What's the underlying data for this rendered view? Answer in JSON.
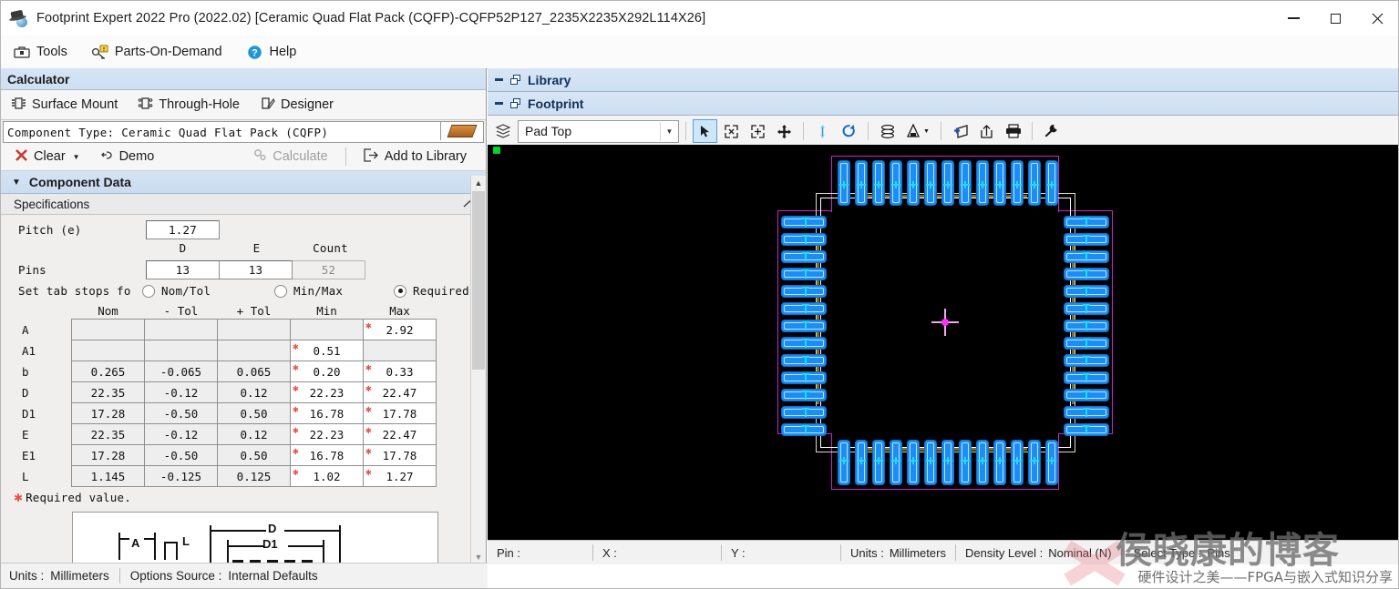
{
  "window": {
    "title": "Footprint Expert 2022 Pro (2022.02) [Ceramic Quad Flat Pack (CQFP)-CQFP52P127_2235X2235X292L114X26]",
    "app_icon": "chip-hat-icon",
    "minimize": "—",
    "maximize": "□",
    "close": "✕"
  },
  "menubar": {
    "items": [
      {
        "label": "Tools",
        "icon": "toolbox-icon"
      },
      {
        "label": "Parts-On-Demand",
        "icon": "parts-on-demand-icon"
      },
      {
        "label": "Help",
        "icon": "help-question-icon"
      }
    ]
  },
  "calculator": {
    "header": "Calculator",
    "tabs": [
      {
        "label": "Surface Mount",
        "icon": "surface-mount-icon"
      },
      {
        "label": "Through-Hole",
        "icon": "through-hole-icon"
      },
      {
        "label": "Designer",
        "icon": "designer-icon"
      }
    ],
    "component_type": "Component Type: Ceramic Quad Flat Pack (CQFP)",
    "actions": [
      {
        "label": "Clear",
        "icon": "red-x-icon",
        "enabled": true,
        "has_dropdown": true
      },
      {
        "label": "Demo",
        "icon": "hand-pointer-icon",
        "enabled": true
      },
      {
        "label": "Calculate",
        "icon": "gears-icon",
        "enabled": false
      },
      {
        "label": "Add to Library",
        "icon": "export-arrow-icon",
        "enabled": true
      }
    ],
    "component_data_header": "Component Data",
    "specifications_header": "Specifications",
    "pitch": {
      "label": "Pitch (e)",
      "value": "1.27"
    },
    "pins": {
      "label": "Pins",
      "col_headers": [
        "D",
        "E",
        "Count"
      ],
      "d": "13",
      "e": "13",
      "count": "52"
    },
    "tab_stops": {
      "label": "Set tab stops fo",
      "options": [
        {
          "label": "Nom/Tol",
          "selected": false
        },
        {
          "label": "Min/Max",
          "selected": false
        },
        {
          "label": "Required.",
          "selected": true
        }
      ]
    },
    "dim_table": {
      "headers": [
        "Nom",
        "- Tol",
        "+ Tol",
        "Min",
        "Max"
      ],
      "rows": [
        {
          "name": "A",
          "nom": "",
          "mtol": "",
          "ptol": "",
          "min": "",
          "max": "2.92",
          "min_req": false,
          "max_req": true,
          "min_ro": true,
          "max_ro": false
        },
        {
          "name": "A1",
          "nom": "",
          "mtol": "",
          "ptol": "",
          "min": "0.51",
          "max": "",
          "min_req": true,
          "max_req": false,
          "min_ro": false,
          "max_ro": true
        },
        {
          "name": "b",
          "nom": "0.265",
          "mtol": "-0.065",
          "ptol": "0.065",
          "min": "0.20",
          "max": "0.33",
          "min_req": true,
          "max_req": true,
          "min_ro": false,
          "max_ro": false
        },
        {
          "name": "D",
          "nom": "22.35",
          "mtol": "-0.12",
          "ptol": "0.12",
          "min": "22.23",
          "max": "22.47",
          "min_req": true,
          "max_req": true,
          "min_ro": false,
          "max_ro": false
        },
        {
          "name": "D1",
          "nom": "17.28",
          "mtol": "-0.50",
          "ptol": "0.50",
          "min": "16.78",
          "max": "17.78",
          "min_req": true,
          "max_req": true,
          "min_ro": false,
          "max_ro": false
        },
        {
          "name": "E",
          "nom": "22.35",
          "mtol": "-0.12",
          "ptol": "0.12",
          "min": "22.23",
          "max": "22.47",
          "min_req": true,
          "max_req": true,
          "min_ro": false,
          "max_ro": false
        },
        {
          "name": "E1",
          "nom": "17.28",
          "mtol": "-0.50",
          "ptol": "0.50",
          "min": "16.78",
          "max": "17.78",
          "min_req": true,
          "max_req": true,
          "min_ro": false,
          "max_ro": false
        },
        {
          "name": "L",
          "nom": "1.145",
          "mtol": "-0.125",
          "ptol": "0.125",
          "min": "1.02",
          "max": "1.27",
          "min_req": true,
          "max_req": true,
          "min_ro": false,
          "max_ro": false
        }
      ]
    },
    "required_note": "Required value.",
    "diagram_labels": [
      "A",
      "L",
      "D",
      "D1"
    ]
  },
  "docks": {
    "library": {
      "title": "Library",
      "minimize_icon": "minimize-icon",
      "restore_icon": "restore-icon"
    },
    "footprint": {
      "title": "Footprint",
      "minimize_icon": "minimize-icon",
      "restore_icon": "restore-icon"
    }
  },
  "footprint_toolbar": {
    "layers_icon": "layers-icon",
    "layer_selected": "Pad Top",
    "dropdown_icon": "chevron-down-icon",
    "buttons": [
      {
        "name": "select-arrow-tool",
        "icon": "cursor-arrow-icon",
        "active": true
      },
      {
        "name": "zoom-fit-tool",
        "icon": "zoom-fit-icon",
        "active": false
      },
      {
        "name": "zoom-window-tool",
        "icon": "zoom-window-icon",
        "active": false
      },
      {
        "name": "pan-tool",
        "icon": "pan-move-icon",
        "active": false
      },
      {
        "name": "flip-vertical-tool",
        "icon": "flip-vertical-icon",
        "active": false
      },
      {
        "name": "rotate-tool",
        "icon": "rotate-icon",
        "active": false
      },
      {
        "name": "layers-stack-tool",
        "icon": "layer-stack-icon",
        "active": false
      },
      {
        "name": "measure-tool",
        "icon": "measure-icon",
        "active": false,
        "has_dropdown": true
      },
      {
        "name": "add-to-library-tool",
        "icon": "add-library-icon",
        "active": false
      },
      {
        "name": "export-tool",
        "icon": "export-up-icon",
        "active": false
      },
      {
        "name": "print-tool",
        "icon": "printer-icon",
        "active": false
      },
      {
        "name": "settings-tool",
        "icon": "wrench-icon",
        "active": false
      }
    ]
  },
  "footprint_status": {
    "pin_label": "Pin :",
    "pin_value": "",
    "x_label": "X :",
    "x_value": "",
    "y_label": "Y :",
    "y_value": "",
    "units_label": "Units :",
    "units_value": "Millimeters",
    "density_label": "Density Level :",
    "density_value": "Nominal (N)",
    "select_type_label": "Select Type :",
    "select_type_value": "Pins"
  },
  "bottom_status": {
    "units_label": "Units :",
    "units_value": "Millimeters",
    "options_label": "Options Source :",
    "options_value": "Internal Defaults"
  },
  "watermark": {
    "main": "侯晓康的博客",
    "sub": "硬件设计之美——FPGA与嵌入式知识分享",
    "logo": "x-logo-icon"
  },
  "colors": {
    "pad": "#1a8ef5",
    "courtyard": "#cc22cc",
    "silkscreen": "#ddd9c3",
    "assembly": "#ffffff",
    "origin": "#ff30ff",
    "canvas": "#000000",
    "accent_header": "#cddff2",
    "required_star": "#e8524a"
  },
  "footprint_geometry": {
    "pins_per_side": 13,
    "total_pins": 52,
    "pitch_mm": 1.27,
    "package": "CQFP52P127_2235X2235X292L114X26"
  }
}
